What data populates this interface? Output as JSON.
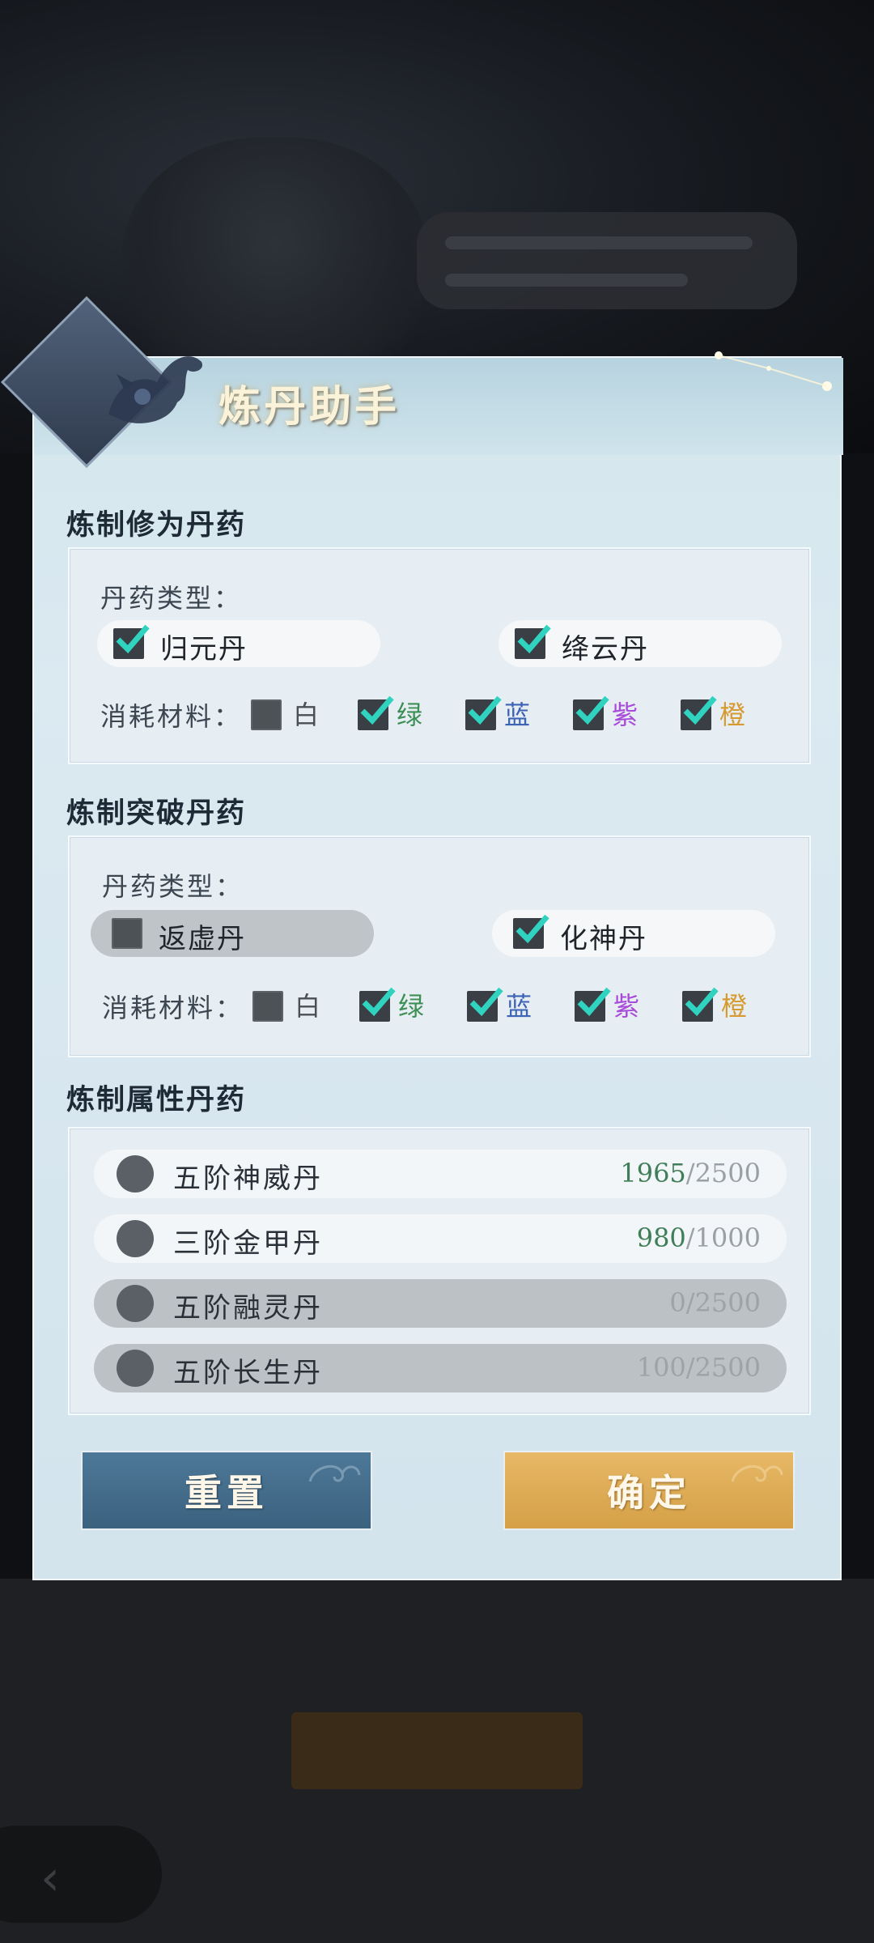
{
  "dialog": {
    "title": "炼丹助手"
  },
  "cultivation": {
    "section_title": "炼制修为丹药",
    "type_label": "丹药类型：",
    "pills": [
      {
        "label": "归元丹",
        "checked": true
      },
      {
        "label": "绛云丹",
        "checked": true
      }
    ],
    "material_label": "消耗材料：",
    "materials": [
      {
        "label": "白",
        "checked": false,
        "color": "#4a4f55"
      },
      {
        "label": "绿",
        "checked": true,
        "color": "#3e8f56"
      },
      {
        "label": "蓝",
        "checked": true,
        "color": "#3d63b5"
      },
      {
        "label": "紫",
        "checked": true,
        "color": "#a74bd8"
      },
      {
        "label": "橙",
        "checked": true,
        "color": "#d79a2e"
      }
    ]
  },
  "breakthrough": {
    "section_title": "炼制突破丹药",
    "type_label": "丹药类型：",
    "pills": [
      {
        "label": "返虚丹",
        "checked": false
      },
      {
        "label": "化神丹",
        "checked": true
      }
    ],
    "material_label": "消耗材料：",
    "materials": [
      {
        "label": "白",
        "checked": false,
        "color": "#4a4f55"
      },
      {
        "label": "绿",
        "checked": true,
        "color": "#3e8f56"
      },
      {
        "label": "蓝",
        "checked": true,
        "color": "#3d63b5"
      },
      {
        "label": "紫",
        "checked": true,
        "color": "#a74bd8"
      },
      {
        "label": "橙",
        "checked": true,
        "color": "#d79a2e"
      }
    ]
  },
  "attribute": {
    "section_title": "炼制属性丹药",
    "items": [
      {
        "name": "五阶神威丹",
        "current": "1965",
        "sep_total": "/2500",
        "enabled": true
      },
      {
        "name": "三阶金甲丹",
        "current": "980",
        "sep_total": "/1000",
        "enabled": true
      },
      {
        "name": "五阶融灵丹",
        "current": "0",
        "sep_total": "/2500",
        "enabled": false
      },
      {
        "name": "五阶长生丹",
        "current": "100",
        "sep_total": "/2500",
        "enabled": false
      }
    ]
  },
  "buttons": {
    "reset": "重置",
    "confirm": "确定"
  },
  "colors": {
    "checkmark": "#2fd3c0",
    "reset_button": "#456d8c",
    "confirm_button": "#dba852"
  }
}
